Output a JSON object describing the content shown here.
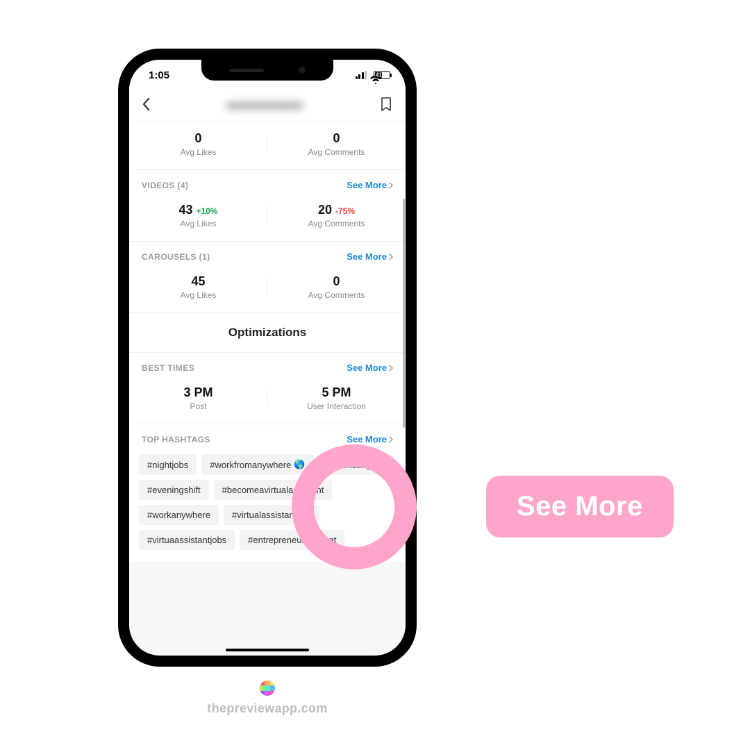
{
  "status_bar": {
    "time": "1:05",
    "battery_label": "41"
  },
  "nav": {
    "title_blurred": "●●●●●●●●●●●"
  },
  "top_card": {
    "likes": {
      "value": "0",
      "label": "Avg Likes"
    },
    "comments": {
      "value": "0",
      "label": "Avg Comments"
    }
  },
  "videos": {
    "header": "VIDEOS (4)",
    "see_more": "See More",
    "likes": {
      "value": "43",
      "delta": "+10%",
      "label": "Avg Likes"
    },
    "comments": {
      "value": "20",
      "delta": "-75%",
      "label": "Avg Comments"
    }
  },
  "carousels": {
    "header": "CAROUSELS (1)",
    "see_more": "See More",
    "likes": {
      "value": "45",
      "label": "Avg Likes"
    },
    "comments": {
      "value": "0",
      "label": "Avg Comments"
    }
  },
  "optimizations_heading": "Optimizations",
  "best_times": {
    "header": "BEST TIMES",
    "see_more": "See More",
    "post": {
      "value": "3 PM",
      "label": "Post"
    },
    "interaction": {
      "value": "5 PM",
      "label": "User Interaction"
    }
  },
  "top_hashtags": {
    "header": "TOP HASHTAGS",
    "see_more": "See More",
    "tags": [
      "#nightjobs",
      "#workfromanywhere",
      "#marketingtips",
      "#eveningshift",
      "#becomeavirtualassistant",
      "#workanywhere",
      "#virtualassistanttips",
      "#virtuaassistantjobs",
      "#entrepreneurmindset"
    ],
    "earth_emoji": "🌎"
  },
  "callout_label": "See More",
  "footer_text": "thepreviewapp.com"
}
